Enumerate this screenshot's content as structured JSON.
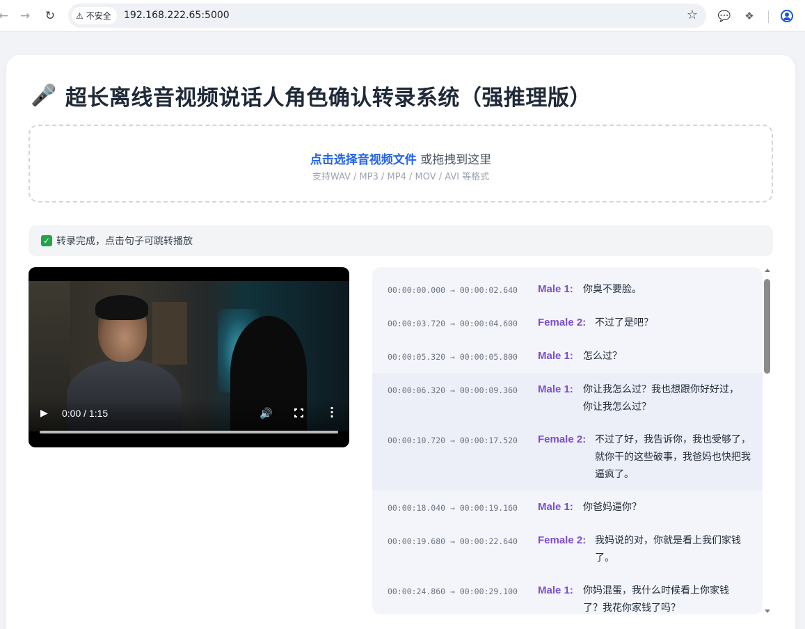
{
  "browser": {
    "back_icon": "arrow-left-icon",
    "forward_icon": "arrow-right-icon",
    "reload_icon": "reload-icon",
    "security_label": "不安全",
    "url": "192.168.222.65:5000"
  },
  "page": {
    "title_icon": "🎤",
    "title": "超长离线音视频说话人角色确认转录系统（强推理版）"
  },
  "upload": {
    "link_text": "点击选择音视频文件",
    "suffix_text": " 或拖拽到这里",
    "hint": "支持WAV / MP3 / MP4 / MOV / AVI 等格式"
  },
  "status": {
    "icon": "✓",
    "text": "转录完成，点击句子可跳转播放"
  },
  "video": {
    "time": "0:00 / 1:15",
    "progress": 0
  },
  "transcript": [
    {
      "start": "00:00:00.000",
      "end": "00:00:02.640",
      "speaker": "Male 1:",
      "text": "你臭不要脸。"
    },
    {
      "start": "00:00:03.720",
      "end": "00:00:04.600",
      "speaker": "Female 2:",
      "text": "不过了是吧？"
    },
    {
      "start": "00:00:05.320",
      "end": "00:00:05.800",
      "speaker": "Male 1:",
      "text": "怎么过？"
    },
    {
      "start": "00:00:06.320",
      "end": "00:00:09.360",
      "speaker": "Male 1:",
      "text": "你让我怎么过？我也想跟你好好过，你让我怎么过？"
    },
    {
      "start": "00:00:10.720",
      "end": "00:00:17.520",
      "speaker": "Female 2:",
      "text": "不过了好，我告诉你，我也受够了，就你干的这些破事，我爸妈也快把我逼疯了。"
    },
    {
      "start": "00:00:18.040",
      "end": "00:00:19.160",
      "speaker": "Male 1:",
      "text": "你爸妈逼你？"
    },
    {
      "start": "00:00:19.680",
      "end": "00:00:22.640",
      "speaker": "Female 2:",
      "text": "我妈说的对，你就是看上我们家钱了。"
    },
    {
      "start": "00:00:24.860",
      "end": "00:00:29.100",
      "speaker": "Male 1:",
      "text": "你妈混蛋，我什么时候看上你家钱了？我花你家钱了吗？"
    }
  ],
  "colors": {
    "accent_link": "#2563eb",
    "speaker": "#7c4dcb",
    "status_check": "#22a447"
  }
}
